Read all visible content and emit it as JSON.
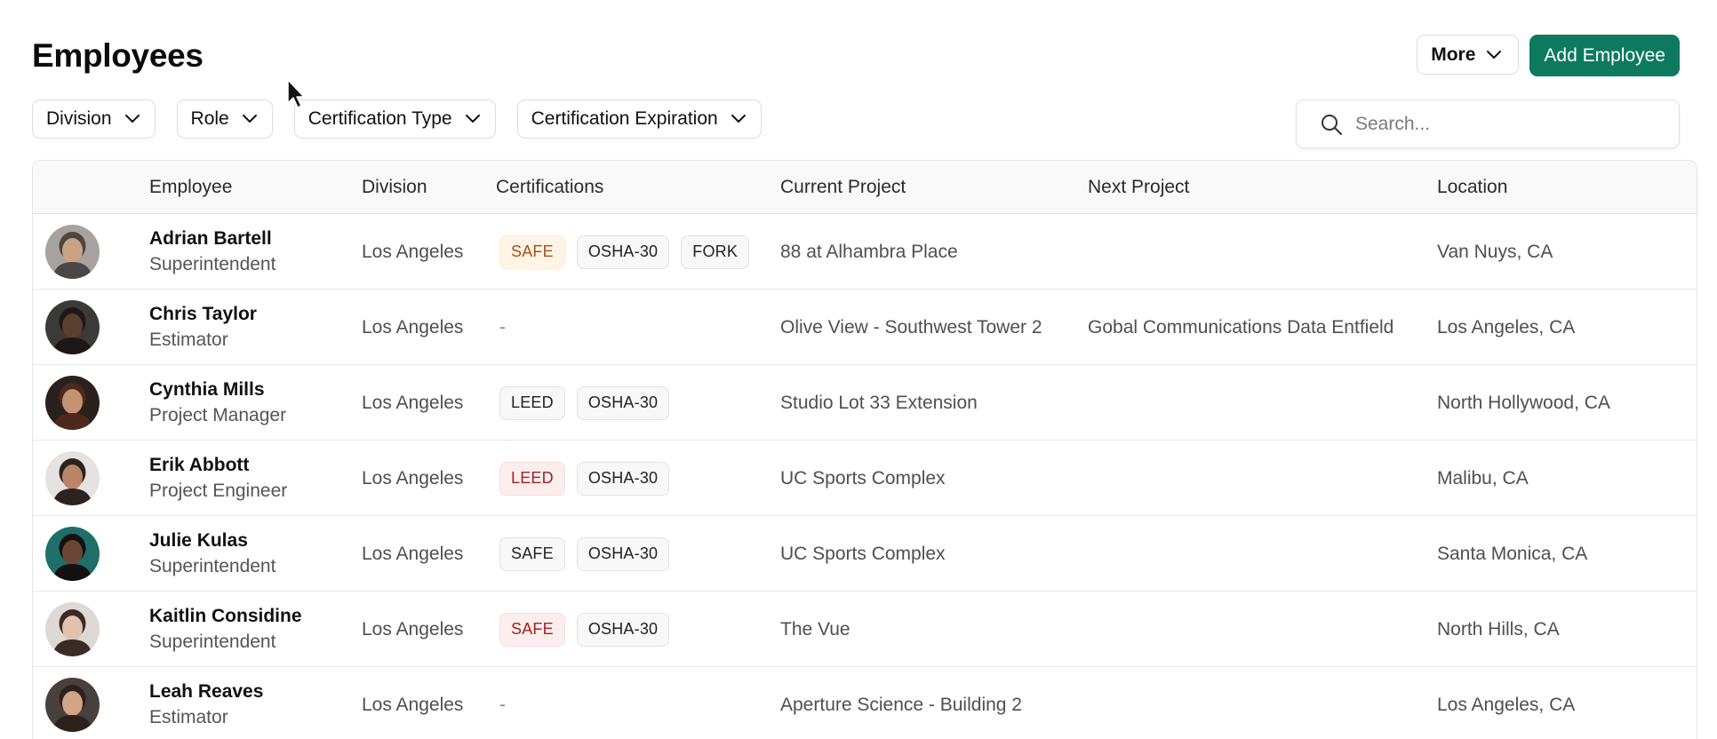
{
  "page": {
    "title": "Employees"
  },
  "actions": {
    "more_label": "More",
    "add_label": "Add Employee",
    "accent": "#0d7a5f"
  },
  "filters": [
    {
      "label": "Division"
    },
    {
      "label": "Role"
    },
    {
      "label": "Certification Type"
    },
    {
      "label": "Certification Expiration"
    }
  ],
  "search": {
    "placeholder": "Search...",
    "value": ""
  },
  "table": {
    "columns": [
      "",
      "Employee",
      "Division",
      "Certifications",
      "Current Project",
      "Next Project",
      "Location"
    ],
    "rows": [
      {
        "name": "Adrian Bartell",
        "role": "Superintendent",
        "division": "Los Angeles",
        "certs": [
          {
            "label": "SAFE",
            "status": "warning"
          },
          {
            "label": "OSHA-30",
            "status": "ok"
          },
          {
            "label": "FORK",
            "status": "ok"
          }
        ],
        "current_project": "88 at Alhambra Place",
        "next_project": "",
        "location": "Van Nuys, CA",
        "avatar": {
          "skin": "#c9a385",
          "hair": "#4a4644",
          "bg": "#a7a29d"
        }
      },
      {
        "name": "Chris Taylor",
        "role": "Estimator",
        "division": "Los Angeles",
        "certs": [],
        "certs_empty": "-",
        "current_project": "Olive View - Southwest Tower 2",
        "next_project": "Gobal Communications Data Entfield",
        "location": "Los Angeles, CA",
        "avatar": {
          "skin": "#5a3e2e",
          "hair": "#1d1815",
          "bg": "#3c3a38"
        }
      },
      {
        "name": "Cynthia Mills",
        "role": "Project Manager",
        "division": "Los Angeles",
        "certs": [
          {
            "label": "LEED",
            "status": "ok"
          },
          {
            "label": "OSHA-30",
            "status": "ok"
          }
        ],
        "current_project": "Studio Lot 33 Extension",
        "next_project": "",
        "location": "North Hollywood, CA",
        "avatar": {
          "skin": "#c59274",
          "hair": "#4b2a1b",
          "bg": "#2a211d"
        }
      },
      {
        "name": "Erik Abbott",
        "role": "Project Engineer",
        "division": "Los Angeles",
        "certs": [
          {
            "label": "LEED",
            "status": "alert"
          },
          {
            "label": "OSHA-30",
            "status": "ok"
          }
        ],
        "current_project": "UC Sports Complex",
        "next_project": "",
        "location": "Malibu, CA",
        "avatar": {
          "skin": "#b98467",
          "hair": "#2b2320",
          "bg": "#e6e2df"
        }
      },
      {
        "name": "Julie Kulas",
        "role": "Superintendent",
        "division": "Los Angeles",
        "certs": [
          {
            "label": "SAFE",
            "status": "ok"
          },
          {
            "label": "OSHA-30",
            "status": "ok"
          }
        ],
        "current_project": "UC Sports Complex",
        "next_project": "",
        "location": "Santa Monica, CA",
        "avatar": {
          "skin": "#6b4634",
          "hair": "#141110",
          "bg": "#1f6e6a"
        }
      },
      {
        "name": "Kaitlin Considine",
        "role": "Superintendent",
        "division": "Los Angeles",
        "certs": [
          {
            "label": "SAFE",
            "status": "alert"
          },
          {
            "label": "OSHA-30",
            "status": "ok"
          }
        ],
        "current_project": "The Vue",
        "next_project": "",
        "location": "North Hills, CA",
        "avatar": {
          "skin": "#e1c2ad",
          "hair": "#3a2c25",
          "bg": "#ded9d4"
        }
      },
      {
        "name": "Leah Reaves",
        "role": "Estimator",
        "division": "Los Angeles",
        "certs": [],
        "certs_empty": "-",
        "current_project": "Aperture Science - Building 2",
        "next_project": "",
        "location": "Los Angeles, CA",
        "avatar": {
          "skin": "#d2a488",
          "hair": "#2d211b",
          "bg": "#47403c"
        }
      }
    ]
  }
}
